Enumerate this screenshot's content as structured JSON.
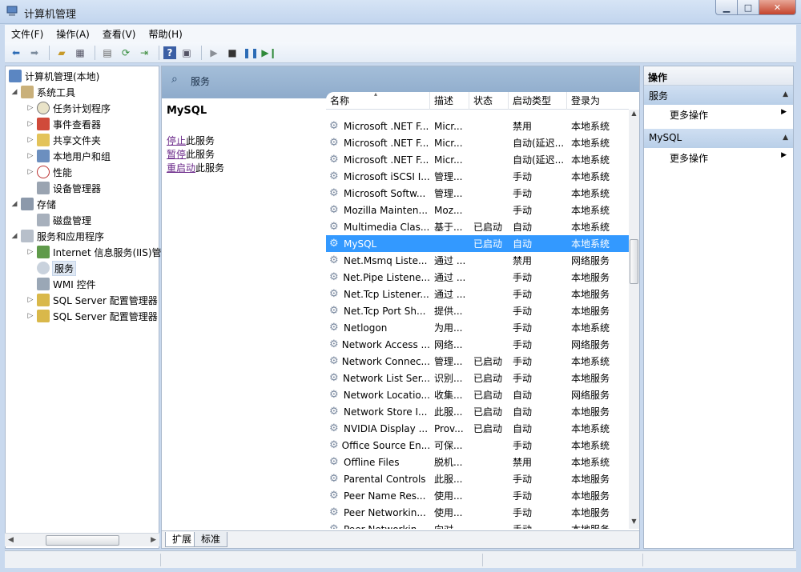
{
  "window": {
    "title": "计算机管理",
    "minimize": "▁",
    "maximize": "□",
    "close": "✕"
  },
  "menu": [
    "文件(F)",
    "操作(A)",
    "查看(V)",
    "帮助(H)"
  ],
  "toolbar": {
    "icons": [
      "back-icon",
      "forward-icon",
      "up-folder-icon",
      "show-hide-tree-icon",
      "properties-icon",
      "refresh-icon",
      "export-icon",
      "help-icon",
      "show-action-pane-icon",
      "start-service-icon",
      "stop-service-icon",
      "pause-service-icon",
      "restart-service-icon"
    ]
  },
  "tree": {
    "root": "计算机管理(本地)",
    "items": [
      {
        "label": "系统工具",
        "level": 1,
        "expanded": true,
        "icon": "tools-icon"
      },
      {
        "label": "任务计划程序",
        "level": 2,
        "icon": "clock-icon"
      },
      {
        "label": "事件查看器",
        "level": 2,
        "icon": "event-viewer-icon"
      },
      {
        "label": "共享文件夹",
        "level": 2,
        "icon": "shared-folder-icon"
      },
      {
        "label": "本地用户和组",
        "level": 2,
        "icon": "users-icon"
      },
      {
        "label": "性能",
        "level": 2,
        "icon": "performance-icon"
      },
      {
        "label": "设备管理器",
        "level": 2,
        "icon": "device-manager-icon"
      },
      {
        "label": "存储",
        "level": 1,
        "expanded": true,
        "icon": "storage-icon"
      },
      {
        "label": "磁盘管理",
        "level": 2,
        "icon": "disk-icon"
      },
      {
        "label": "服务和应用程序",
        "level": 1,
        "expanded": true,
        "icon": "services-apps-icon"
      },
      {
        "label": "Internet 信息服务(IIS)管",
        "level": 2,
        "icon": "iis-icon"
      },
      {
        "label": "服务",
        "level": 2,
        "icon": "gear-icon",
        "selected": true
      },
      {
        "label": "WMI 控件",
        "level": 2,
        "icon": "wmi-icon"
      },
      {
        "label": "SQL Server 配置管理器",
        "level": 2,
        "icon": "sql-server-icon"
      },
      {
        "label": "SQL Server 配置管理器",
        "level": 2,
        "icon": "sql-server-icon"
      }
    ]
  },
  "center": {
    "header": "服务",
    "detail": {
      "title": "MySQL",
      "stop_link": "停止",
      "stop_text": "此服务",
      "pause_link": "暂停",
      "pause_text": "此服务",
      "restart_link": "重启动",
      "restart_text": "此服务"
    },
    "columns": [
      "名称",
      "描述",
      "状态",
      "启动类型",
      "登录为"
    ],
    "rows": [
      [
        "Microsoft .NET F...",
        "Micr...",
        "",
        "禁用",
        "本地系统"
      ],
      [
        "Microsoft .NET F...",
        "Micr...",
        "",
        "自动(延迟...",
        "本地系统"
      ],
      [
        "Microsoft .NET F...",
        "Micr...",
        "",
        "自动(延迟...",
        "本地系统"
      ],
      [
        "Microsoft iSCSI I...",
        "管理...",
        "",
        "手动",
        "本地系统"
      ],
      [
        "Microsoft Softw...",
        "管理...",
        "",
        "手动",
        "本地系统"
      ],
      [
        "Mozilla Mainten...",
        "Moz...",
        "",
        "手动",
        "本地系统"
      ],
      [
        "Multimedia Clas...",
        "基于...",
        "已启动",
        "自动",
        "本地系统"
      ],
      [
        "MySQL",
        "",
        "已启动",
        "自动",
        "本地系统"
      ],
      [
        "Net.Msmq Liste...",
        "通过 ...",
        "",
        "禁用",
        "网络服务"
      ],
      [
        "Net.Pipe Listene...",
        "通过 ...",
        "",
        "手动",
        "本地服务"
      ],
      [
        "Net.Tcp Listener...",
        "通过 ...",
        "",
        "手动",
        "本地服务"
      ],
      [
        "Net.Tcp Port Sh...",
        "提供...",
        "",
        "手动",
        "本地服务"
      ],
      [
        "Netlogon",
        "为用...",
        "",
        "手动",
        "本地系统"
      ],
      [
        "Network Access ...",
        "网络...",
        "",
        "手动",
        "网络服务"
      ],
      [
        "Network Connec...",
        "管理...",
        "已启动",
        "手动",
        "本地系统"
      ],
      [
        "Network List Ser...",
        "识别...",
        "已启动",
        "手动",
        "本地服务"
      ],
      [
        "Network Locatio...",
        "收集...",
        "已启动",
        "自动",
        "网络服务"
      ],
      [
        "Network Store I...",
        "此服...",
        "已启动",
        "自动",
        "本地服务"
      ],
      [
        "NVIDIA Display ...",
        "Prov...",
        "已启动",
        "自动",
        "本地系统"
      ],
      [
        "Office Source En...",
        "可保...",
        "",
        "手动",
        "本地系统"
      ],
      [
        "Offline Files",
        "脱机...",
        "",
        "禁用",
        "本地系统"
      ],
      [
        "Parental Controls",
        "此服...",
        "",
        "手动",
        "本地服务"
      ],
      [
        "Peer Name Res...",
        "使用...",
        "",
        "手动",
        "本地服务"
      ],
      [
        "Peer Networkin...",
        "使用...",
        "",
        "手动",
        "本地服务"
      ],
      [
        "Peer Networkin...",
        "向对...",
        "",
        "手动",
        "本地服务"
      ]
    ],
    "selected_row": 7,
    "tabs": [
      "扩展",
      "标准"
    ]
  },
  "actions": {
    "header": "操作",
    "sections": [
      {
        "title": "服务",
        "item": "更多操作"
      },
      {
        "title": "MySQL",
        "item": "更多操作"
      }
    ]
  }
}
